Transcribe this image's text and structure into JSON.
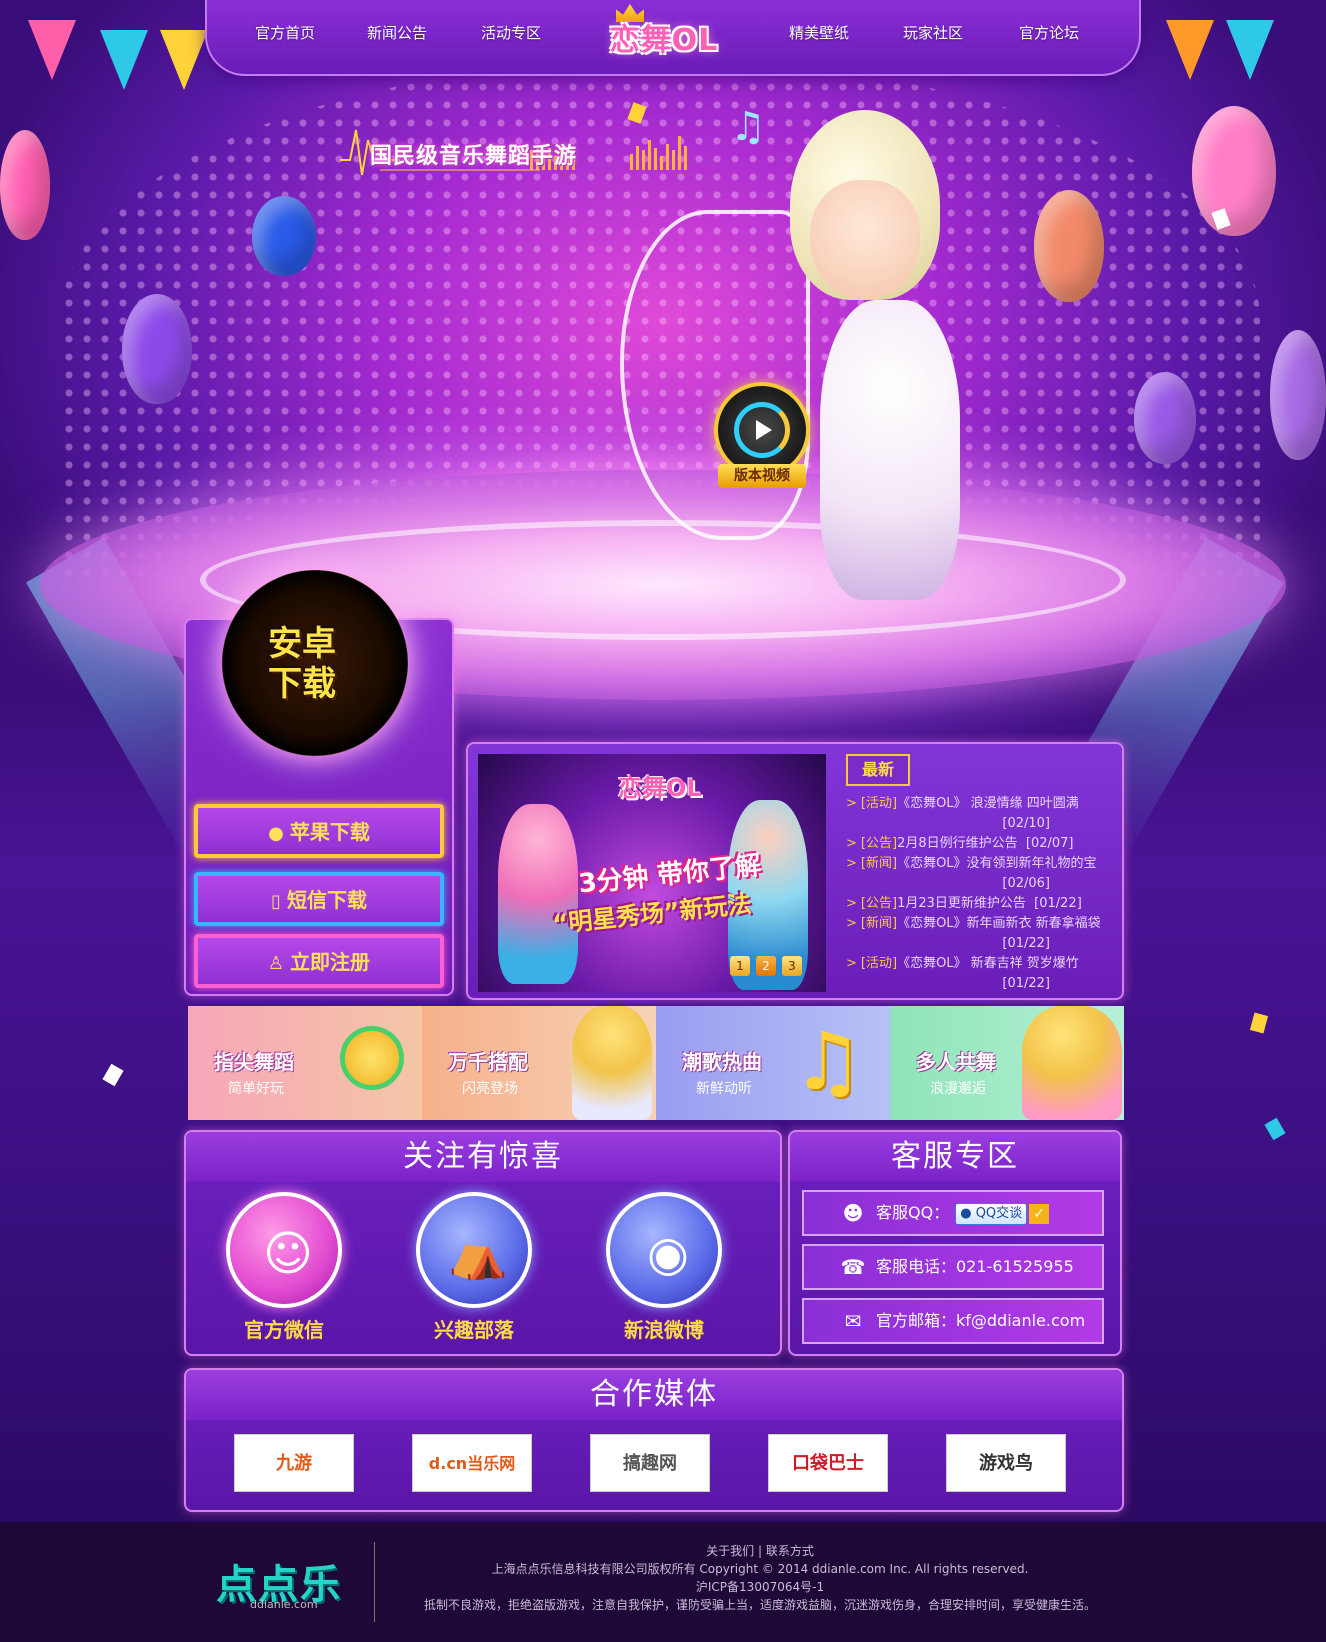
{
  "nav": {
    "items": [
      "官方首页",
      "新闻公告",
      "活动专区",
      "精美壁纸",
      "玩家社区",
      "官方论坛"
    ],
    "logo": "恋舞OL"
  },
  "hero": {
    "slogan": "国民级音乐舞蹈手游",
    "video_label": "版本视频"
  },
  "download": {
    "android": "安卓下载",
    "android_line1": "安卓",
    "android_line2": "下载",
    "apple": "苹果下载",
    "sms": "短信下载",
    "register": "立即注册"
  },
  "banner": {
    "logo": "恋舞OL",
    "line1": "3分钟 带你了解",
    "line2": "“明星秀场”新玩法",
    "pages": [
      "1",
      "2",
      "3"
    ],
    "active_page": "2"
  },
  "news": {
    "tab": "最新",
    "items": [
      {
        "cat": "[活动]",
        "title": "《恋舞OL》 浪漫情缘 四叶圆满",
        "date": "[02/10]"
      },
      {
        "cat": "[公告]",
        "title": "2月8日例行维护公告",
        "date": "[02/07]"
      },
      {
        "cat": "[新闻]",
        "title": "《恋舞OL》没有领到新年礼物的宝",
        "date": "[02/06]"
      },
      {
        "cat": "[公告]",
        "title": "1月23日更新维护公告",
        "date": "[01/22]"
      },
      {
        "cat": "[新闻]",
        "title": "《恋舞OL》新年画新衣 新春拿福袋",
        "date": "[01/22]"
      },
      {
        "cat": "[活动]",
        "title": "《恋舞OL》 新春吉祥 贺岁爆竹",
        "date": "[01/22]"
      }
    ]
  },
  "features": [
    {
      "title": "指尖舞蹈",
      "sub": "简单好玩"
    },
    {
      "title": "万千搭配",
      "sub": "闪亮登场"
    },
    {
      "title": "潮歌热曲",
      "sub": "新鲜动听"
    },
    {
      "title": "多人共舞",
      "sub": "浪漫邂逅"
    }
  ],
  "follow": {
    "title": "关注有惊喜",
    "items": [
      "官方微信",
      "兴趣部落",
      "新浪微博"
    ]
  },
  "service": {
    "title": "客服专区",
    "qq_label": "客服QQ：",
    "qq_button": "QQ交谈",
    "phone": "客服电话：021-61525955",
    "email": "官方邮箱：kf@ddianle.com"
  },
  "partners": {
    "title": "合作媒体",
    "items": [
      "九游",
      "d.cn当乐网",
      "搞趣网",
      "口袋巴士",
      "游戏鸟"
    ]
  },
  "footer": {
    "logo": "点点乐",
    "logo_sub": "ddianle.com",
    "about": "关于我们",
    "contact": "联系方式",
    "copyright": "上海点点乐信息科技有限公司版权所有 Copyright © 2014 ddianle.com Inc. All rights reserved.",
    "icp": "沪ICP备13007064号-1",
    "notice": "抵制不良游戏，拒绝盗版游戏，注意自我保护，谨防受骗上当，适度游戏益脑，沉迷游戏伤身，合理安排时间，享受健康生活。"
  }
}
